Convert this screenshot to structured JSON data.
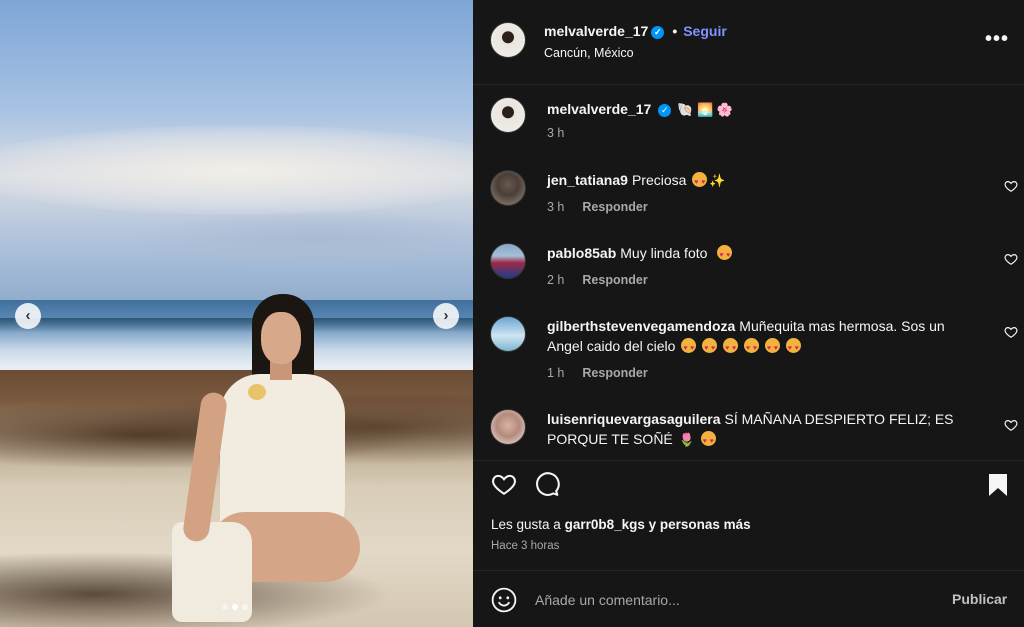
{
  "post": {
    "author": "melvalverde_17",
    "follow_label": "Seguir",
    "dot": "•",
    "location": "Cancún, México",
    "more_label": "•••",
    "caption_emojis": "🐚 🌅 🌸",
    "caption_time": "3 h"
  },
  "carousel": {
    "prev_label": "‹",
    "next_label": "›",
    "slide_index": 1,
    "slide_count": 3
  },
  "comments": [
    {
      "user": "jen_tatiana9",
      "text": "Preciosa",
      "emoji": "✨",
      "time": "3 h",
      "reply": "Responder"
    },
    {
      "user": "pablo85ab",
      "text": "Muy linda foto",
      "time": "2 h",
      "reply": "Responder"
    },
    {
      "user": "gilberthstevenvegamendoza",
      "text": "Muñequita mas hermosa. Sos un Angel caido del cielo",
      "time": "1 h",
      "reply": "Responder"
    },
    {
      "user": "luisenriquevargasaguilera",
      "text": "SÍ MAÑANA DESPIERTO FELIZ; ES PORQUE TE SOÑÉ",
      "emoji": "🌷"
    }
  ],
  "likes": {
    "prefix": "Les gusta a",
    "user": "garr0b8_kgs",
    "suffix": "y personas más",
    "ago": "Hace 3 horas"
  },
  "composer": {
    "placeholder": "Añade un comentario...",
    "publish": "Publicar"
  },
  "colors": {
    "panel_bg": "#161616",
    "accent_link": "#7f94ff",
    "verified": "#0095f6"
  }
}
